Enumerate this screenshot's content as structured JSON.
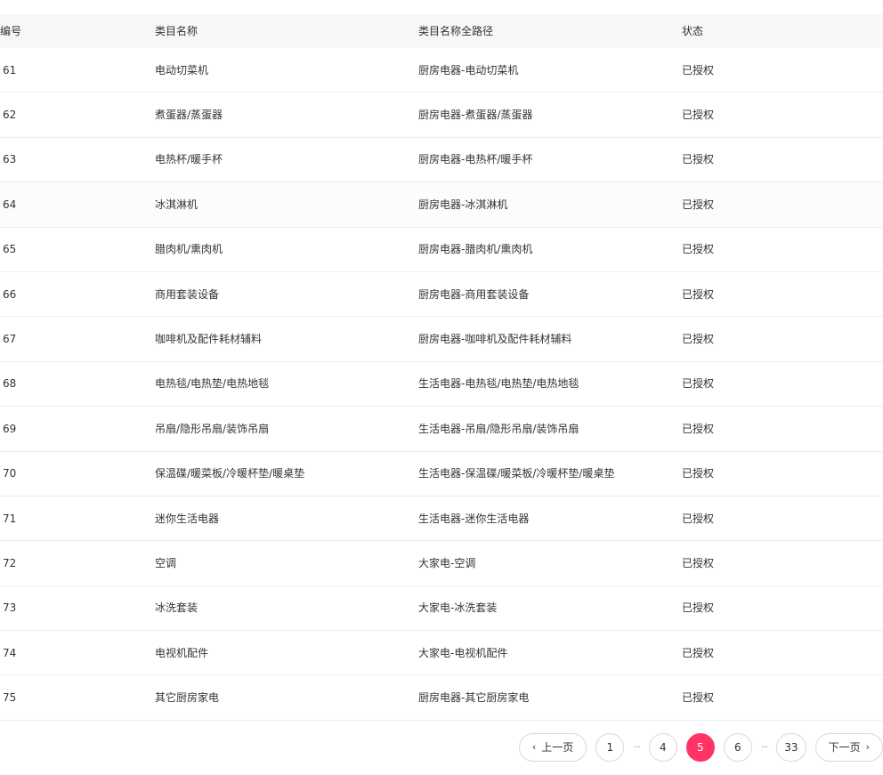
{
  "table": {
    "headers": [
      "编号",
      "类目名称",
      "类目名称全路径",
      "状态"
    ],
    "rows": [
      {
        "id": "61",
        "name": "电动切菜机",
        "path": "厨房电器-电动切菜机",
        "status": "已授权"
      },
      {
        "id": "62",
        "name": "煮蛋器/蒸蛋器",
        "path": "厨房电器-煮蛋器/蒸蛋器",
        "status": "已授权"
      },
      {
        "id": "63",
        "name": "电热杯/暖手杯",
        "path": "厨房电器-电热杯/暖手杯",
        "status": "已授权"
      },
      {
        "id": "64",
        "name": "冰淇淋机",
        "path": "厨房电器-冰淇淋机",
        "status": "已授权"
      },
      {
        "id": "65",
        "name": "腊肉机/熏肉机",
        "path": "厨房电器-腊肉机/熏肉机",
        "status": "已授权"
      },
      {
        "id": "66",
        "name": "商用套装设备",
        "path": "厨房电器-商用套装设备",
        "status": "已授权"
      },
      {
        "id": "67",
        "name": "咖啡机及配件耗材辅料",
        "path": "厨房电器-咖啡机及配件耗材辅料",
        "status": "已授权"
      },
      {
        "id": "68",
        "name": "电热毯/电热垫/电热地毯",
        "path": "生活电器-电热毯/电热垫/电热地毯",
        "status": "已授权"
      },
      {
        "id": "69",
        "name": "吊扇/隐形吊扇/装饰吊扇",
        "path": "生活电器-吊扇/隐形吊扇/装饰吊扇",
        "status": "已授权"
      },
      {
        "id": "70",
        "name": "保温碟/暖菜板/冷暖杯垫/暖桌垫",
        "path": "生活电器-保温碟/暖菜板/冷暖杯垫/暖桌垫",
        "status": "已授权"
      },
      {
        "id": "71",
        "name": "迷你生活电器",
        "path": "生活电器-迷你生活电器",
        "status": "已授权"
      },
      {
        "id": "72",
        "name": "空调",
        "path": "大家电-空调",
        "status": "已授权"
      },
      {
        "id": "73",
        "name": "冰洗套装",
        "path": "大家电-冰洗套装",
        "status": "已授权"
      },
      {
        "id": "74",
        "name": "电视机配件",
        "path": "大家电-电视机配件",
        "status": "已授权"
      },
      {
        "id": "75",
        "name": "其它厨房家电",
        "path": "厨房电器-其它厨房家电",
        "status": "已授权"
      }
    ]
  },
  "pagination": {
    "prev_label": "上一页",
    "next_label": "下一页",
    "ellipsis": "···",
    "pages": [
      "1",
      "…",
      "4",
      "5",
      "6",
      "…",
      "33"
    ],
    "current": "5",
    "accent_color": "#ff3366"
  }
}
